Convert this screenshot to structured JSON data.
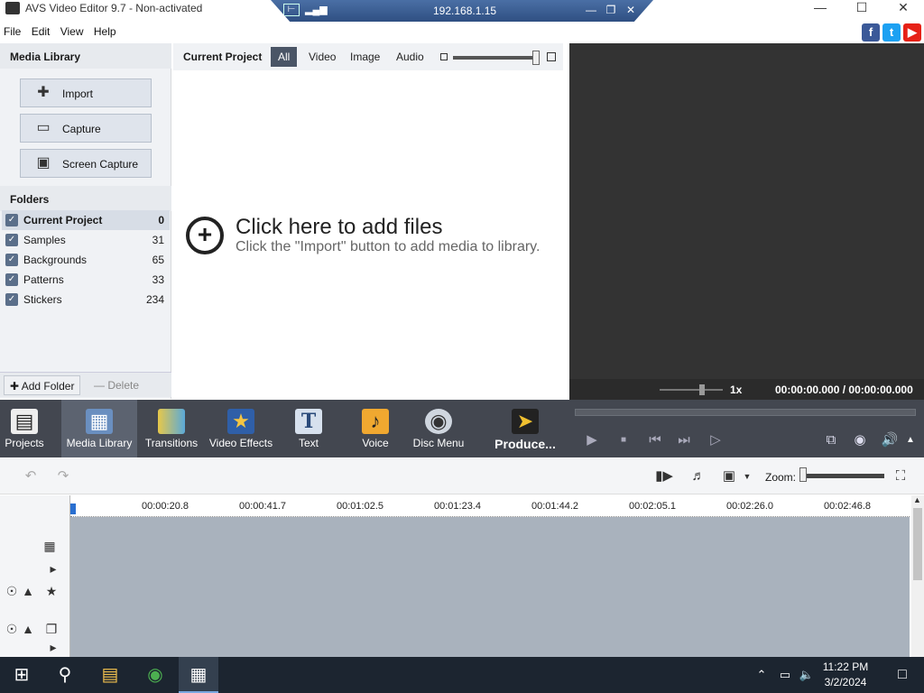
{
  "window": {
    "title": "AVS Video Editor 9.7 - Non-activated"
  },
  "remote": {
    "ip": "192.168.1.15"
  },
  "menu": [
    "File",
    "Edit",
    "View",
    "Help"
  ],
  "media_library": {
    "header": "Media Library",
    "buttons": [
      "Import",
      "Capture",
      "Screen Capture"
    ],
    "folders_header": "Folders",
    "folders": [
      {
        "name": "Current Project",
        "count": "0"
      },
      {
        "name": "Samples",
        "count": "31"
      },
      {
        "name": "Backgrounds",
        "count": "65"
      },
      {
        "name": "Patterns",
        "count": "33"
      },
      {
        "name": "Stickers",
        "count": "234"
      }
    ],
    "add_folder": "Add Folder",
    "delete_folder": "Delete Folder"
  },
  "project": {
    "title": "Current Project",
    "filters": [
      "All",
      "Video",
      "Image",
      "Audio"
    ],
    "empty_title": "Click here to add files",
    "empty_sub": "Click the \"Import\" button to add media to library."
  },
  "preview": {
    "speed": "1x",
    "timecode": "00:00:00.000 / 00:00:00.000"
  },
  "tools": [
    {
      "label": "Projects",
      "icon": "clapperboard-icon"
    },
    {
      "label": "Media Library",
      "icon": "film-strip-icon"
    },
    {
      "label": "Transitions",
      "icon": "transition-icon"
    },
    {
      "label": "Video Effects",
      "icon": "star-effect-icon"
    },
    {
      "label": "Text",
      "icon": "text-icon"
    },
    {
      "label": "Voice",
      "icon": "microphone-icon"
    },
    {
      "label": "Disc Menu",
      "icon": "disc-icon"
    },
    {
      "label": "Produce...",
      "icon": "produce-icon"
    }
  ],
  "timeline": {
    "zoom_label": "Zoom:",
    "ticks": [
      "00:00:20.8",
      "00:00:41.7",
      "00:01:02.5",
      "00:01:23.4",
      "00:01:44.2",
      "00:02:05.1",
      "00:02:26.0",
      "00:02:46.8"
    ]
  },
  "taskbar": {
    "time": "11:22 PM",
    "date": "3/2/2024"
  }
}
